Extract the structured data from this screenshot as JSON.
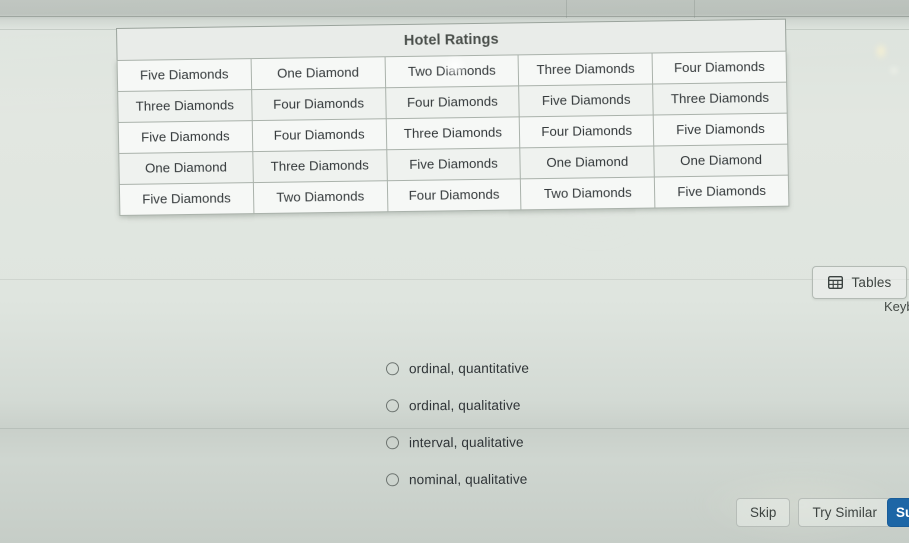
{
  "table": {
    "title": "Hotel Ratings",
    "rows": [
      [
        "Five Diamonds",
        "One Diamond",
        "Two Diamonds",
        "Three Diamonds",
        "Four Diamonds"
      ],
      [
        "Three Diamonds",
        "Four Diamonds",
        "Four Diamonds",
        "Five Diamonds",
        "Three Diamonds"
      ],
      [
        "Five Diamonds",
        "Four Diamonds",
        "Three Diamonds",
        "Four Diamonds",
        "Five Diamonds"
      ],
      [
        "One Diamond",
        "Three Diamonds",
        "Five Diamonds",
        "One Diamond",
        "One Diamond"
      ],
      [
        "Five Diamonds",
        "Two Diamonds",
        "Four Diamonds",
        "Two Diamonds",
        "Five Diamonds"
      ]
    ]
  },
  "toolbar": {
    "tables_label": "Tables",
    "tables_icon": "table-grid-icon",
    "keyboard_hint": "Keyb"
  },
  "options": [
    {
      "label": "ordinal, quantitative",
      "selected": false
    },
    {
      "label": "ordinal, qualitative",
      "selected": false
    },
    {
      "label": "interval, qualitative",
      "selected": false
    },
    {
      "label": "nominal, qualitative",
      "selected": false
    }
  ],
  "actions": {
    "skip_label": "Skip",
    "try_similar_label": "Try Similar",
    "submit_label": "Submit"
  },
  "colors": {
    "background": "#dfe5df",
    "primary_button": "#1d66a6",
    "table_border": "#aab2ab",
    "text": "#33383a"
  }
}
